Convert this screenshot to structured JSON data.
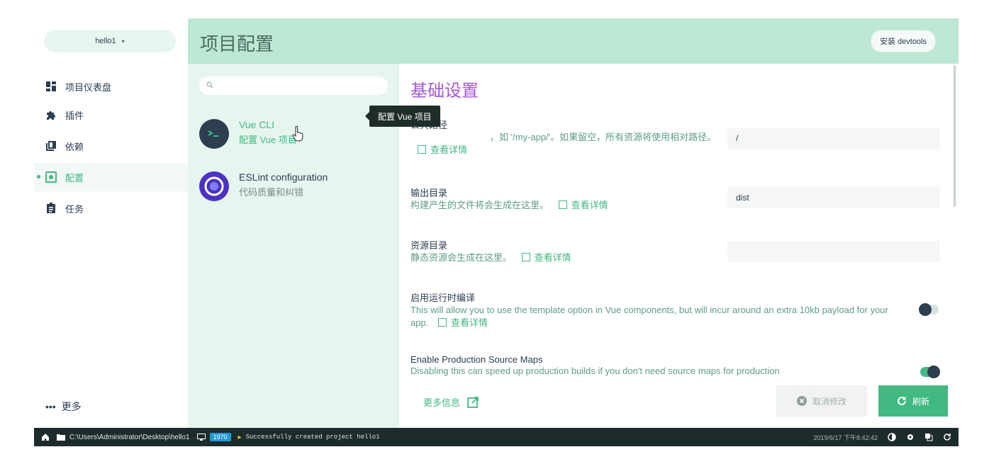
{
  "project_selector": {
    "label": "hello1",
    "caret": "▾"
  },
  "header": {
    "title": "项目配置",
    "devtools_button": "安装 devtools"
  },
  "nav": {
    "items": [
      {
        "label": "项目仪表盘",
        "icon": "dashboard-icon"
      },
      {
        "label": "插件",
        "icon": "puzzle-icon"
      },
      {
        "label": "依赖",
        "icon": "library-icon"
      },
      {
        "label": "配置",
        "icon": "settings-application-icon",
        "active": true
      },
      {
        "label": "任务",
        "icon": "assignment-icon"
      }
    ],
    "more": {
      "icon_text": "•••",
      "label": "更多"
    }
  },
  "plugins": {
    "search_placeholder": "",
    "items": [
      {
        "name": "Vue CLI",
        "description": "配置 Vue 项目",
        "selected": true
      },
      {
        "name": "ESLint configuration",
        "description": "代码质量和纠错"
      }
    ]
  },
  "tooltip": {
    "text": "配置 Vue 项目"
  },
  "main": {
    "section_title": "基础设置",
    "fields": [
      {
        "label": "公共路径",
        "help_before": "",
        "help_visible": "，如 '/my-app/'。如果留空，所有资源将使用相对路径。",
        "link": "查看详情",
        "value": "/"
      },
      {
        "label": "输出目录",
        "help": "构建产生的文件将会生成在这里。",
        "link": "查看详情",
        "value": "dist"
      },
      {
        "label": "资源目录",
        "help": "静态资源会生成在这里。",
        "link": "查看详情",
        "value": ""
      },
      {
        "label": "启用运行时编译",
        "help": "This will allow you to use the template option in Vue components, but will incur around an extra 10kb payload for your app.",
        "link": "查看详情",
        "toggle": false
      },
      {
        "label": "Enable Production Source Maps",
        "help": "Disabling this can speed up production builds if you don't need source maps for production",
        "toggle": true
      }
    ]
  },
  "actions": {
    "more_info": "更多信息",
    "cancel": "取消修改",
    "refresh": "刷新"
  },
  "statusbar": {
    "path": "C:\\Users\\Administrator\\Desktop\\hello1",
    "port_badge": "1970",
    "message": "Successfully created project hello1",
    "datetime": "2019/6/17 下午8:42:42"
  },
  "colors": {
    "accent": "#42b983",
    "header_bg": "#bde8d4",
    "title_purple": "#a557d4",
    "statusbar_bg": "#1d2b2c"
  }
}
